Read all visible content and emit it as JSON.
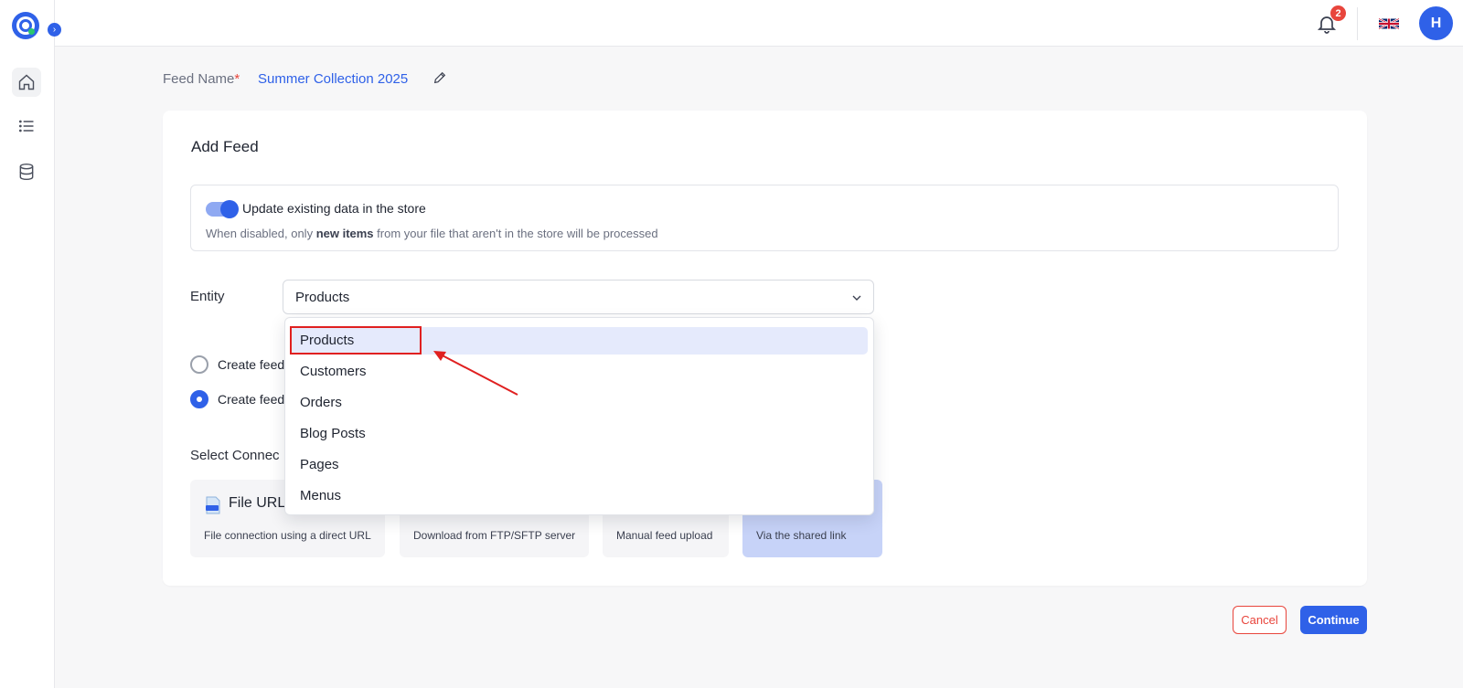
{
  "sidebar": {
    "logo": "app-logo",
    "expand_icon": "›",
    "items": [
      {
        "name": "home",
        "icon": "home-icon",
        "active": true
      },
      {
        "name": "list",
        "icon": "list-icon",
        "active": false
      },
      {
        "name": "database",
        "icon": "database-icon",
        "active": false
      }
    ]
  },
  "topbar": {
    "notification_count": "2",
    "language_flag": "uk-flag-icon",
    "avatar_initial": "H"
  },
  "feed": {
    "name_label": "Feed Name",
    "required_marker": "*",
    "name_value": "Summer Collection 2025"
  },
  "card": {
    "title": "Add Feed",
    "update_toggle": {
      "label": "Update existing data in the store",
      "enabled": true,
      "desc_prefix": "When disabled, only ",
      "desc_bold": "new items",
      "desc_suffix": " from your file that aren't in the store will be processed"
    },
    "entity": {
      "label": "Entity",
      "selected": "Products",
      "options": [
        "Products",
        "Customers",
        "Orders",
        "Blog Posts",
        "Pages",
        "Menus"
      ]
    },
    "radios": [
      {
        "label": "Create feed",
        "checked": false
      },
      {
        "label": "Create feed",
        "checked": true
      }
    ],
    "connection": {
      "label": "Select Connec",
      "options": [
        {
          "title": "File URL",
          "desc": "File connection using a direct URL",
          "selected": false
        },
        {
          "title": "",
          "desc": "Download from FTP/SFTP server",
          "selected": false
        },
        {
          "title": "",
          "desc": "Manual feed upload",
          "selected": false
        },
        {
          "title": "",
          "desc": "Via the shared link",
          "selected": true
        }
      ]
    }
  },
  "footer": {
    "cancel_label": "Cancel",
    "continue_label": "Continue"
  },
  "colors": {
    "primary": "#2f61e8",
    "danger": "#e8453c",
    "annotation": "#e02020"
  }
}
